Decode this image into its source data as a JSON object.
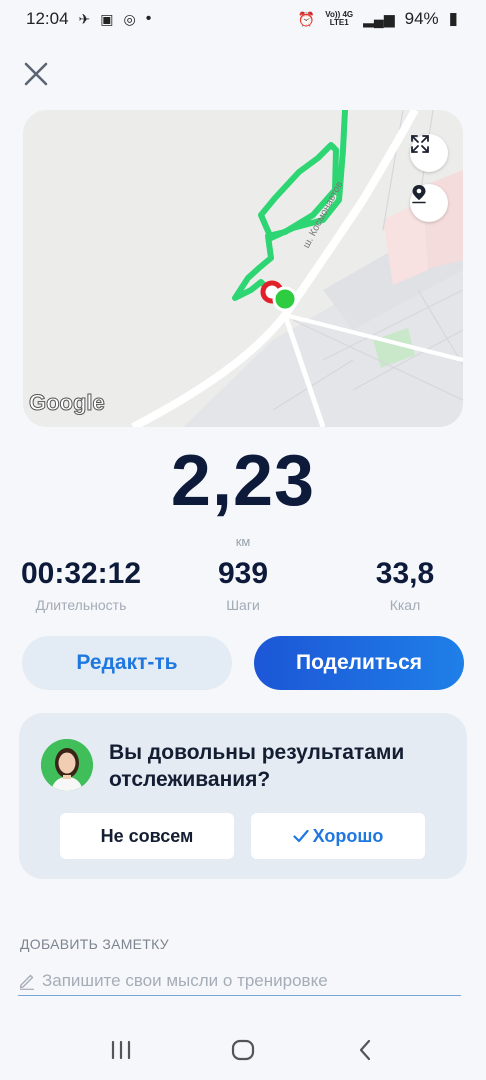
{
  "status_bar": {
    "time": "12:04",
    "battery": "94%",
    "network_top": "Vo)) 4G",
    "network_bottom": "LTE1"
  },
  "workout": {
    "distance": "2,23",
    "distance_unit": "км",
    "stats": [
      {
        "value": "00:32:12",
        "label": "Длительность"
      },
      {
        "value": "939",
        "label": "Шаги"
      },
      {
        "value": "33,8",
        "label": "Ккал"
      }
    ]
  },
  "map": {
    "street_label": "ш. Космонавтов",
    "logo_text": "Google",
    "route_color": "#2ed573",
    "start_color": "#e0202a",
    "end_color": "#2ecc40"
  },
  "actions": {
    "edit_label": "Редакт-ть",
    "share_label": "Поделиться"
  },
  "feedback": {
    "question": "Вы довольны результатами отслеживания?",
    "no_label": "Не совсем",
    "yes_label": "Хорошо"
  },
  "note": {
    "title": "ДОБАВИТЬ ЗАМЕТКУ",
    "placeholder": "Запишите свои мысли о тренировке"
  },
  "colors": {
    "accent": "#1f78e0",
    "text_dark": "#0d1a3a",
    "background": "#f5f7fa"
  }
}
